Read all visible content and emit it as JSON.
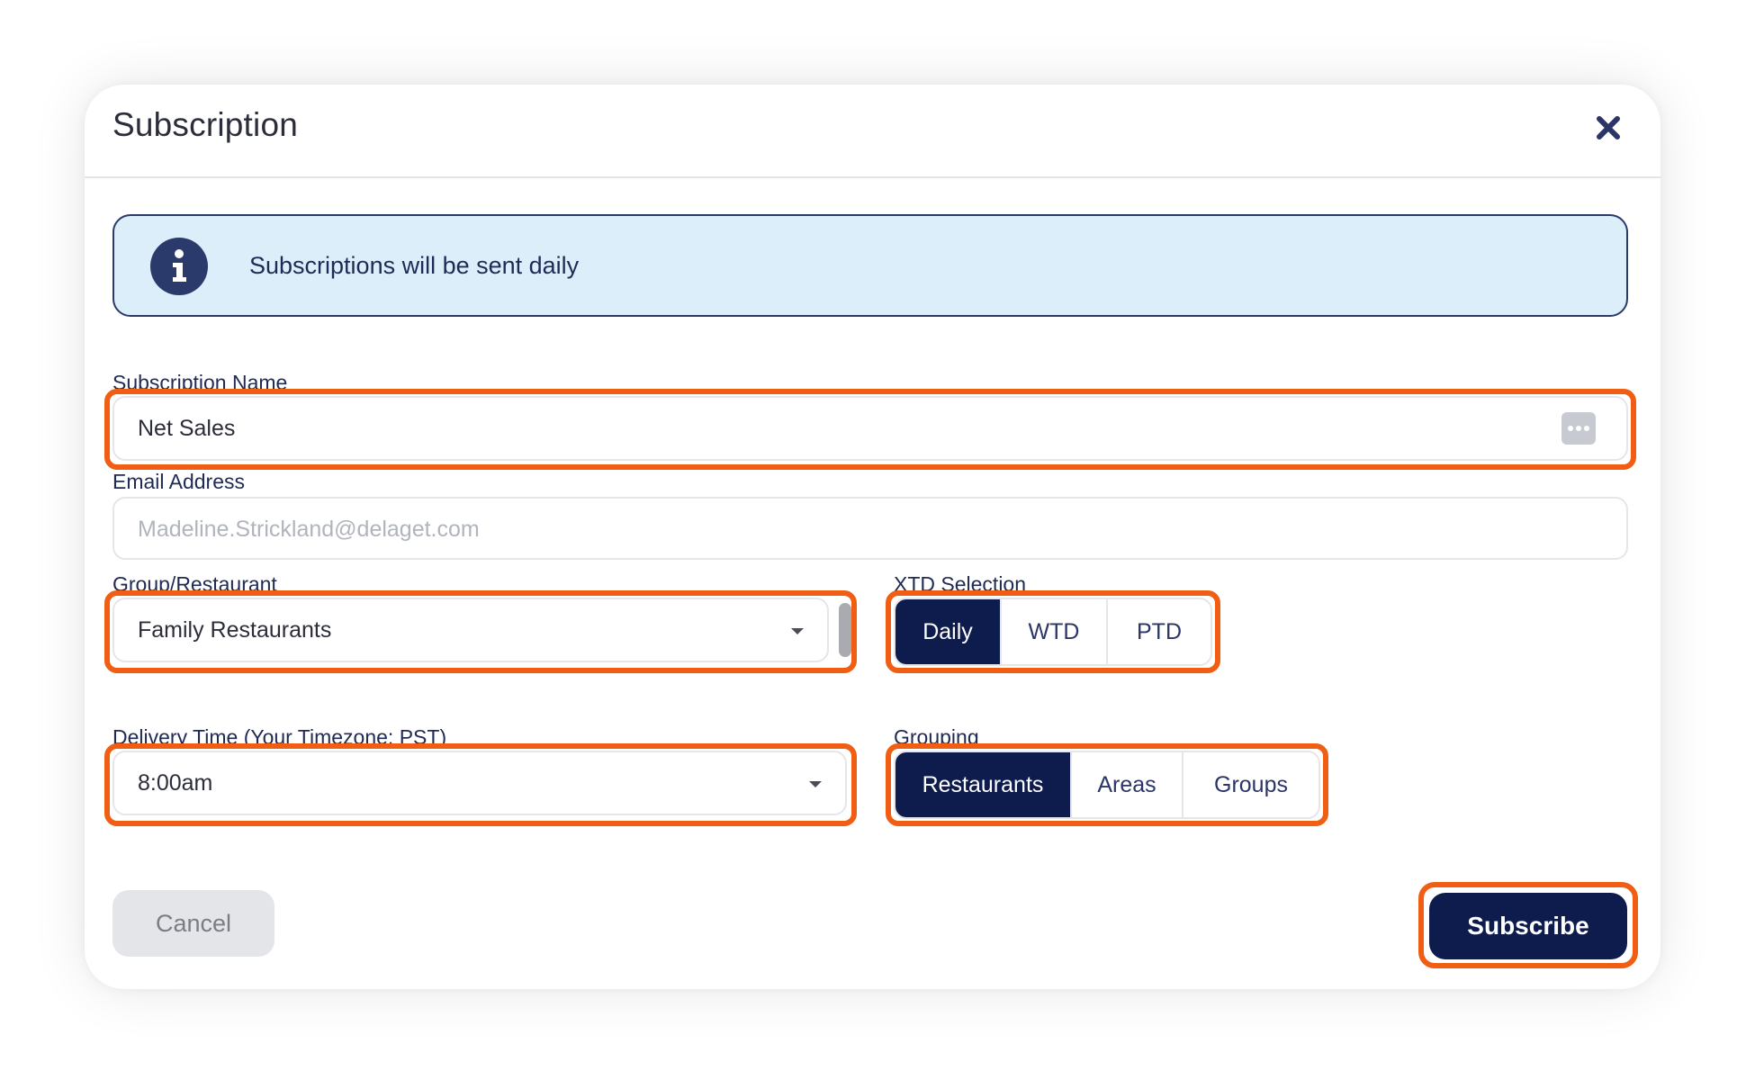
{
  "modal": {
    "title": "Subscription"
  },
  "banner": {
    "text": "Subscriptions will be sent daily",
    "icon": "info-icon"
  },
  "form": {
    "subscription_name": {
      "label": "Subscription Name",
      "value": "Net Sales"
    },
    "email": {
      "label": "Email Address",
      "placeholder": "Madeline.Strickland@delaget.com"
    },
    "group_restaurant": {
      "label": "Group/Restaurant",
      "value": "Family Restaurants"
    },
    "delivery_time": {
      "label": "Delivery Time (Your Timezone: PST)",
      "value": "8:00am"
    },
    "xtd_selection": {
      "label": "XTD Selection",
      "options": [
        "Daily",
        "WTD",
        "PTD"
      ],
      "selected": "Daily"
    },
    "grouping": {
      "label": "Grouping",
      "options": [
        "Restaurants",
        "Areas",
        "Groups"
      ],
      "selected": "Restaurants"
    }
  },
  "actions": {
    "cancel_label": "Cancel",
    "subscribe_label": "Subscribe"
  },
  "colors": {
    "primary": "#0e1b4d",
    "highlight": "#f05e14",
    "banner_bg": "#ddeefb"
  }
}
